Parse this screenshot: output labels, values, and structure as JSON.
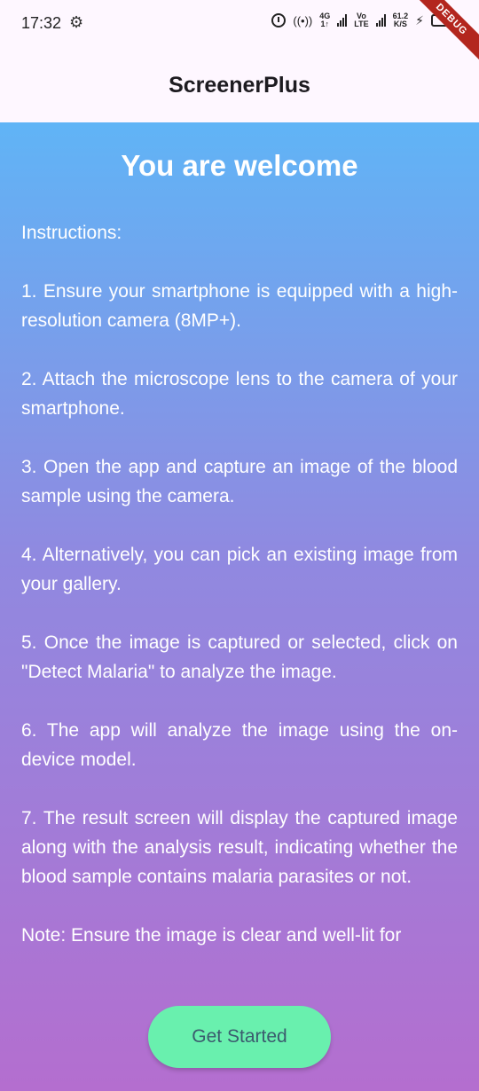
{
  "status_bar": {
    "time": "17:32",
    "network_4g": "4G",
    "network_4g_sub": "1↑",
    "volte": "Vo",
    "volte_sub": "LTE",
    "speed": "61.2",
    "speed_unit": "K/S"
  },
  "debug_banner": "DEBUG",
  "app_bar": {
    "title": "ScreenerPlus"
  },
  "main": {
    "heading": "You are welcome",
    "instructions": [
      "Instructions:",
      "1. Ensure your smartphone is equipped with a high-resolution camera (8MP+).",
      "2. Attach the microscope lens to the camera of your smartphone.",
      "3. Open the app and capture an image of the blood sample using the camera.",
      "4. Alternatively, you can pick an existing image from your gallery.",
      "5. Once the image is captured or selected, click on \"Detect Malaria\" to analyze the image.",
      "6. The app will analyze the image using the on-device model.",
      "7. The result screen will display the captured image along with the analysis result, indicating whether the blood sample contains malaria parasites or not.",
      "Note: Ensure the image is clear and well-lit for"
    ],
    "button_label": "Get Started"
  },
  "colors": {
    "gradient_top": "#60b4f6",
    "gradient_bottom": "#b46ecf",
    "button": "#69f0ae",
    "app_bar_bg": "#fef7ff"
  }
}
